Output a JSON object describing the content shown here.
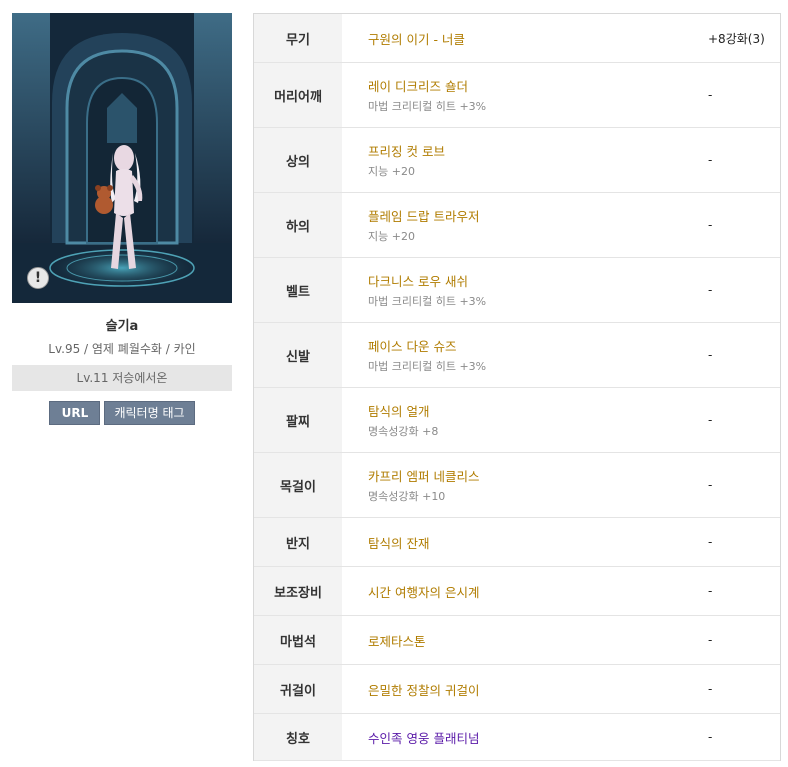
{
  "character": {
    "name": "슬기a",
    "info": "Lv.95 / 염제 폐월수화 / 카인",
    "adventure": "Lv.11 저승에서온",
    "url_button": "URL",
    "tag_button": "캐릭터명 태그",
    "warning_icon": "!"
  },
  "colors": {
    "item_name": "#b07c00",
    "title_item": "#5a1aa8",
    "button": "#6e7f95"
  },
  "equipment": [
    {
      "slot": "무기",
      "name": "구원의 이기 - 너클",
      "stat": "",
      "upgrade": "+8강화(3)"
    },
    {
      "slot": "머리어깨",
      "name": "레이 디크리즈 숄더",
      "stat": "마법 크리티컬 히트 +3%",
      "upgrade": "-"
    },
    {
      "slot": "상의",
      "name": "프리징 컷 로브",
      "stat": "지능 +20",
      "upgrade": "-"
    },
    {
      "slot": "하의",
      "name": "플레임 드랍 트라우저",
      "stat": "지능 +20",
      "upgrade": "-"
    },
    {
      "slot": "벨트",
      "name": "다크니스 로우 새쉬",
      "stat": "마법 크리티컬 히트 +3%",
      "upgrade": "-"
    },
    {
      "slot": "신발",
      "name": "페이스 다운 슈즈",
      "stat": "마법 크리티컬 히트 +3%",
      "upgrade": "-"
    },
    {
      "slot": "팔찌",
      "name": "탐식의 얼개",
      "stat": "명속성강화 +8",
      "upgrade": "-"
    },
    {
      "slot": "목걸이",
      "name": "카프리 엠퍼 네클리스",
      "stat": "명속성강화 +10",
      "upgrade": "-"
    },
    {
      "slot": "반지",
      "name": "탐식의 잔재",
      "stat": "",
      "upgrade": "-"
    },
    {
      "slot": "보조장비",
      "name": "시간 여행자의 은시계",
      "stat": "",
      "upgrade": "-"
    },
    {
      "slot": "마법석",
      "name": "로제타스톤",
      "stat": "",
      "upgrade": "-"
    },
    {
      "slot": "귀걸이",
      "name": "은밀한 정찰의 귀걸이",
      "stat": "",
      "upgrade": "-"
    },
    {
      "slot": "칭호",
      "name": "수인족 영웅 플래티넘",
      "stat": "",
      "upgrade": "-"
    }
  ]
}
